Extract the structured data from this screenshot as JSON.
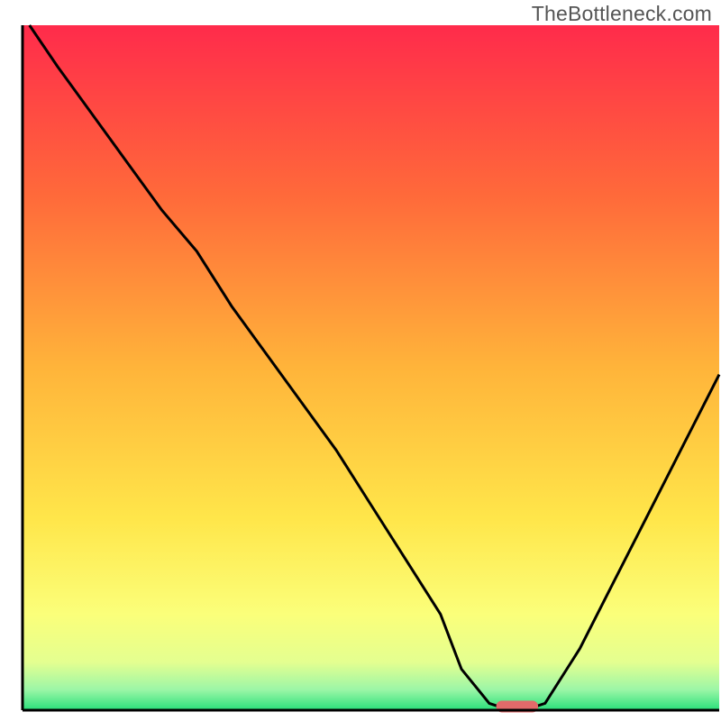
{
  "watermark": "TheBottleneck.com",
  "chart_data": {
    "type": "line",
    "title": "",
    "xlabel": "",
    "ylabel": "",
    "xlim": [
      0,
      100
    ],
    "ylim": [
      0,
      100
    ],
    "x": [
      1,
      5,
      10,
      15,
      20,
      25,
      30,
      35,
      40,
      45,
      50,
      55,
      60,
      63,
      67,
      70,
      72,
      75,
      80,
      85,
      90,
      95,
      100
    ],
    "values": [
      100,
      94,
      87,
      80,
      73,
      67,
      59,
      52,
      45,
      38,
      30,
      22,
      14,
      6,
      1,
      0,
      0,
      1,
      9,
      19,
      29,
      39,
      49
    ],
    "marker": {
      "x_start": 68,
      "x_end": 74,
      "y": 0.6,
      "color": "#e26a6a"
    },
    "gradient_stops": [
      {
        "offset": 0.0,
        "color": "#ff2b4b"
      },
      {
        "offset": 0.25,
        "color": "#ff6a3a"
      },
      {
        "offset": 0.5,
        "color": "#ffb43a"
      },
      {
        "offset": 0.72,
        "color": "#ffe64a"
      },
      {
        "offset": 0.86,
        "color": "#fbff7a"
      },
      {
        "offset": 0.93,
        "color": "#e4ff90"
      },
      {
        "offset": 0.97,
        "color": "#9cf6a7"
      },
      {
        "offset": 1.0,
        "color": "#29e07a"
      }
    ],
    "axis_color": "#000000",
    "line_color": "#000000"
  }
}
